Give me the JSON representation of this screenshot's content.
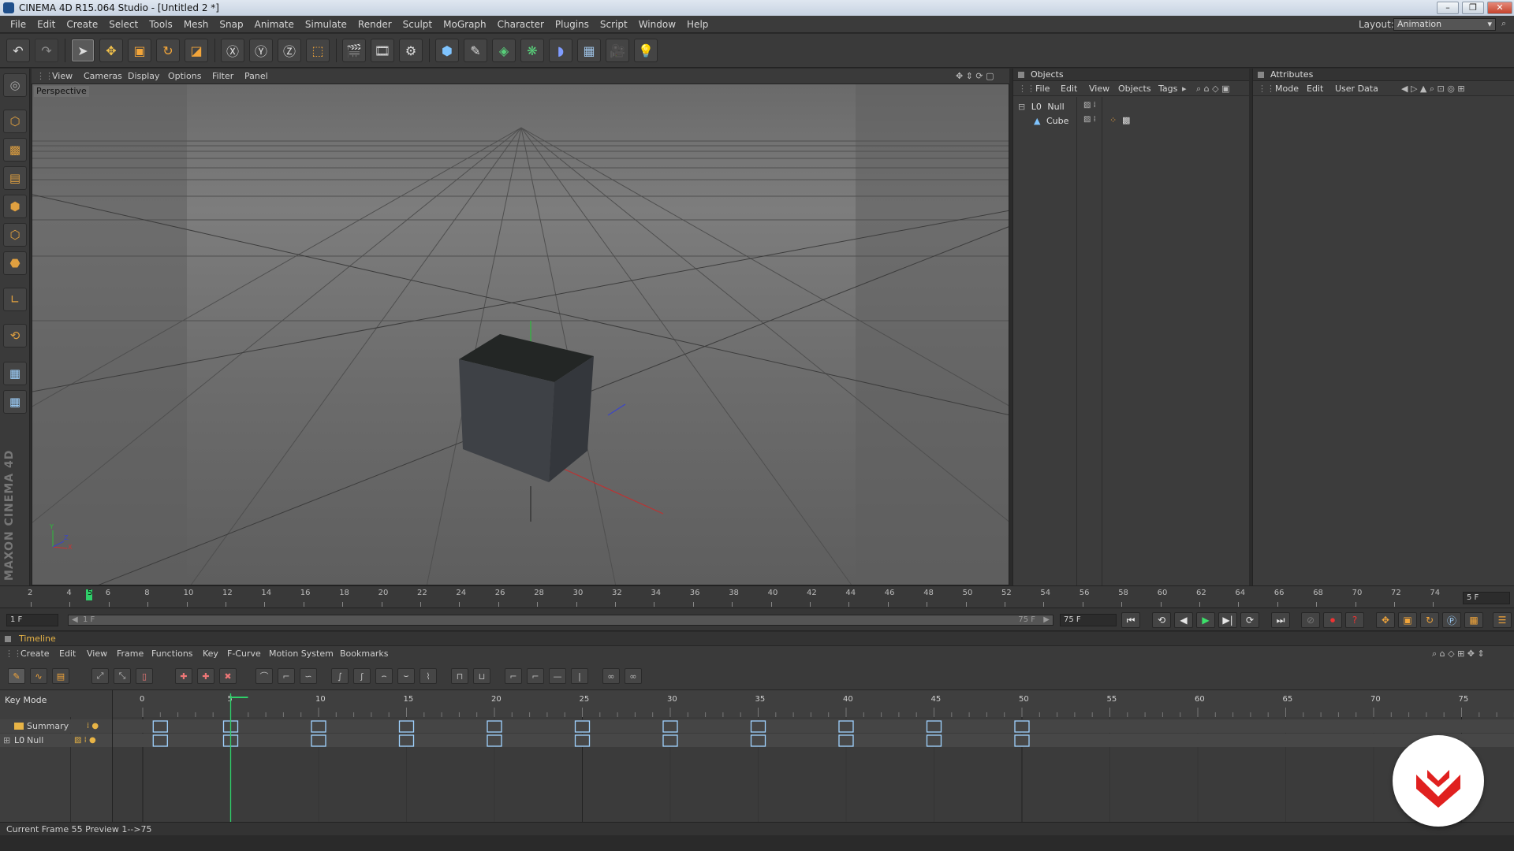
{
  "window": {
    "title": "CINEMA 4D R15.064 Studio - [Untitled 2 *]",
    "buttons": [
      "minimize",
      "restore",
      "close"
    ]
  },
  "menubar": {
    "items": [
      "File",
      "Edit",
      "Create",
      "Select",
      "Tools",
      "Mesh",
      "Snap",
      "Animate",
      "Simulate",
      "Render",
      "Sculpt",
      "MoGraph",
      "Character",
      "Plugins",
      "Script",
      "Window",
      "Help"
    ],
    "layout_label": "Layout:",
    "layout_value": "Animation"
  },
  "viewport": {
    "menu": [
      "View",
      "Cameras",
      "Display",
      "Options",
      "Filter",
      "Panel"
    ],
    "name": "Perspective"
  },
  "objects_panel": {
    "title": "Objects",
    "menu": [
      "File",
      "Edit",
      "View",
      "Objects",
      "Tags"
    ],
    "objects": [
      {
        "name": "Null",
        "icon": "null-icon"
      },
      {
        "name": "Cube",
        "icon": "cube-icon"
      }
    ]
  },
  "attributes_panel": {
    "title": "Attributes",
    "menu": [
      "Mode",
      "Edit",
      "User Data"
    ]
  },
  "ruler": {
    "ticks": [
      "2",
      "4",
      "6",
      "8",
      "10",
      "12",
      "14",
      "16",
      "18",
      "20",
      "22",
      "24",
      "26",
      "28",
      "30",
      "32",
      "34",
      "36",
      "38",
      "40",
      "42",
      "44",
      "46",
      "48",
      "50",
      "52",
      "54",
      "56",
      "58",
      "60",
      "62",
      "64",
      "66",
      "68",
      "70",
      "72",
      "74"
    ],
    "current": "5",
    "right_field": "5 F"
  },
  "playback": {
    "start_frame": "1 F",
    "range_start": "1 F",
    "range_end": "75 F",
    "end_frame": "75 F"
  },
  "timeline": {
    "title": "Timeline",
    "menu": [
      "Create",
      "Edit",
      "View",
      "Frame",
      "Functions",
      "Key",
      "F-Curve",
      "Motion System",
      "Bookmarks"
    ],
    "mode_label": "Key Mode",
    "ruler": [
      "0",
      "5",
      "10",
      "15",
      "20",
      "25",
      "30",
      "35",
      "40",
      "45",
      "50",
      "55",
      "60",
      "65",
      "70",
      "75"
    ],
    "current_frame": 5,
    "tracks": [
      {
        "name": "Summary"
      },
      {
        "name": "Null"
      }
    ],
    "keyframes": [
      1,
      5,
      10,
      15,
      20,
      25,
      30,
      35,
      40,
      45,
      50
    ]
  },
  "status": {
    "text": "Current Frame  55  Preview  1-->75"
  },
  "colors": {
    "accent_green": "#2fd06a",
    "timeline_title": "#e8b446",
    "key_outline": "#9fd2ff",
    "logo_red": "#e0201f"
  }
}
